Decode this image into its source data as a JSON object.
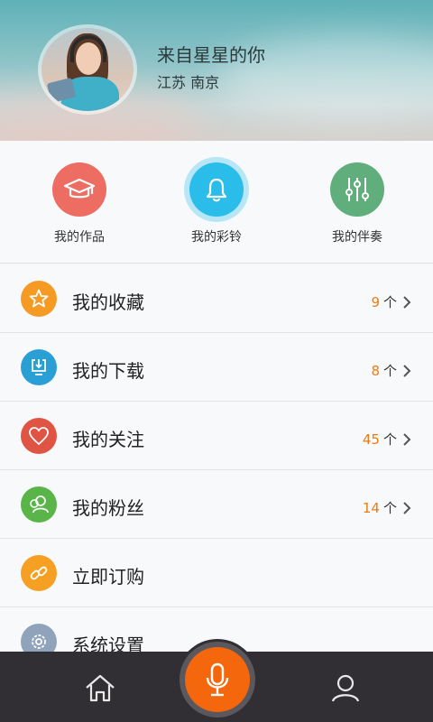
{
  "profile": {
    "name": "来自星星的你",
    "location": "江苏  南京"
  },
  "quick_actions": [
    {
      "label": "我的作品",
      "icon": "graduation-cap-icon",
      "color": "#ee6d62"
    },
    {
      "label": "我的彩铃",
      "icon": "bell-icon",
      "color": "#2bbde9"
    },
    {
      "label": "我的伴奏",
      "icon": "equalizer-sliders-icon",
      "color": "#5fae7b"
    }
  ],
  "menu": [
    {
      "label": "我的收藏",
      "icon": "star-icon",
      "color": "#f59a23",
      "count": "9",
      "unit": "个"
    },
    {
      "label": "我的下载",
      "icon": "download-icon",
      "color": "#2a9fd6",
      "count": "8",
      "unit": "个"
    },
    {
      "label": "我的关注",
      "icon": "heart-icon",
      "color": "#e05444",
      "count": "45",
      "unit": "个"
    },
    {
      "label": "我的粉丝",
      "icon": "fans-icon",
      "color": "#5ab548",
      "count": "14",
      "unit": "个"
    },
    {
      "label": "立即订购",
      "icon": "link-icon",
      "color": "#f5a023"
    },
    {
      "label": "系统设置",
      "icon": "gear-icon",
      "color": "#8fa4bb"
    }
  ],
  "tabbar": {
    "home_icon": "home-icon",
    "record_icon": "microphone-icon",
    "profile_icon": "user-icon",
    "accent": "#f4670c"
  }
}
